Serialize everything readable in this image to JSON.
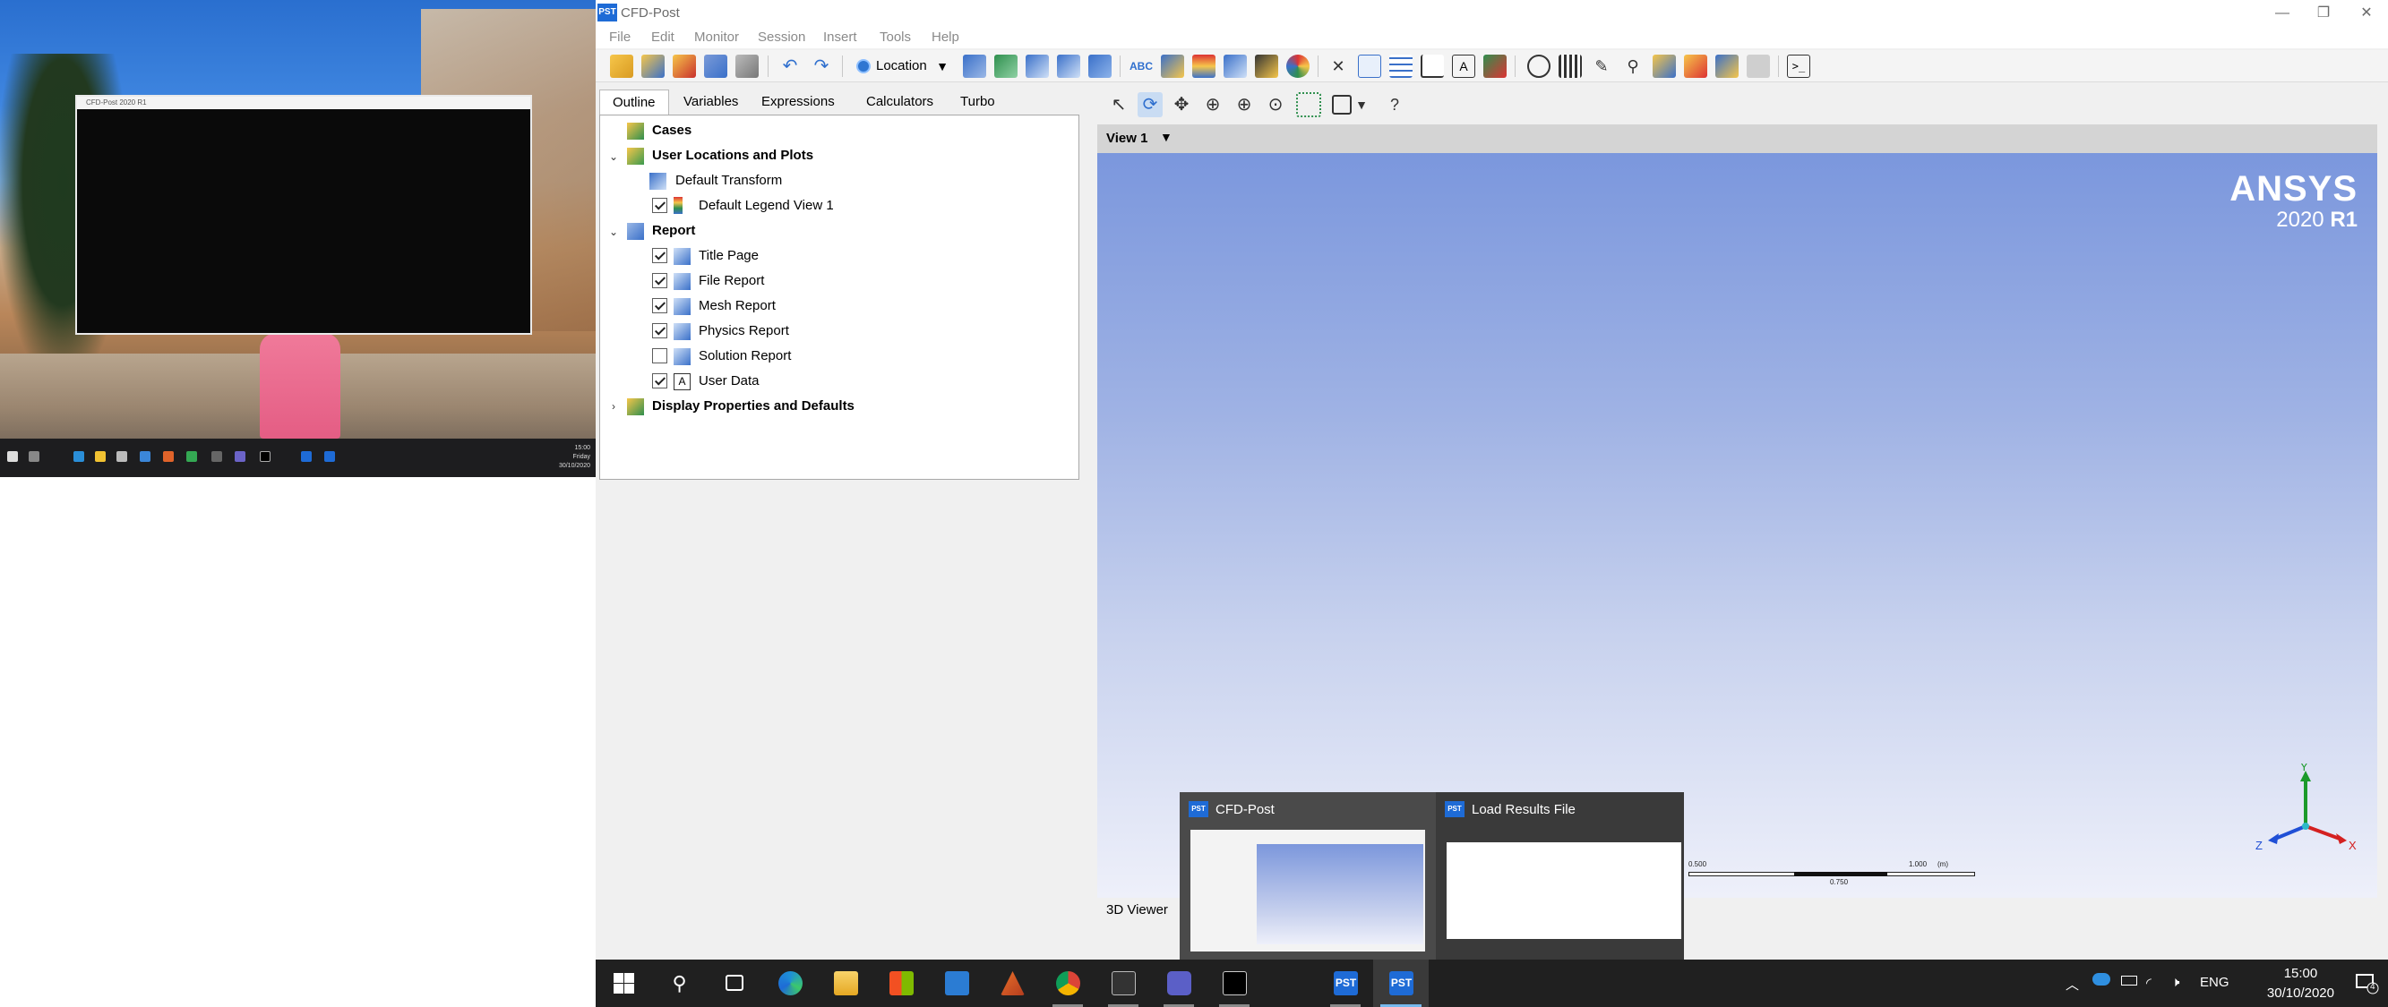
{
  "window": {
    "title": "CFD-Post",
    "icon_text": "PST",
    "minimize": "—",
    "restore": "❐",
    "close": "✕"
  },
  "menu": [
    "File",
    "Edit",
    "Monitor",
    "Session",
    "Insert",
    "Tools",
    "Help"
  ],
  "toolbar": {
    "location_label": "Location"
  },
  "panel": {
    "tabs": [
      "Outline",
      "Variables",
      "Expressions",
      "Calculators",
      "Turbo"
    ],
    "active_tab": "Outline",
    "tree": {
      "cases": "Cases",
      "user_locations": "User Locations and Plots",
      "default_transform": "Default Transform",
      "default_legend": "Default Legend View 1",
      "report": "Report",
      "report_items": [
        {
          "label": "Title Page",
          "checked": true
        },
        {
          "label": "File Report",
          "checked": true
        },
        {
          "label": "Mesh Report",
          "checked": true
        },
        {
          "label": "Physics Report",
          "checked": true
        },
        {
          "label": "Solution Report",
          "checked": false
        },
        {
          "label": "User Data",
          "checked": true
        }
      ],
      "display_properties": "Display Properties and Defaults"
    }
  },
  "viewer": {
    "view_name": "View 1",
    "footer_label": "3D Viewer",
    "brand_name": "ANSYS",
    "brand_year": "2020",
    "brand_release": "R1",
    "scale": {
      "left_label": "0.500",
      "right_label": "1.000",
      "unit": "(m)",
      "mid_label": "0.750"
    },
    "axes": {
      "x": "X",
      "y": "Y",
      "z": "Z"
    }
  },
  "preview": {
    "cards": [
      {
        "icon": "PST",
        "title": "CFD-Post"
      },
      {
        "icon": "PST",
        "title": "Load Results File"
      }
    ]
  },
  "taskbar": {
    "pst_label": "PST",
    "language": "ENG",
    "time": "15:00",
    "date": "30/10/2020",
    "notification_count": "4"
  },
  "second_screen": {
    "window_title": "CFD-Post 2020 R1",
    "clock_time": "15:00",
    "clock_day": "Friday",
    "clock_date": "30/10/2020"
  },
  "colors": {
    "accent": "#1e6bd6",
    "taskbar": "#202020",
    "viewport_top": "#7b97dd",
    "viewport_bottom": "#eef0fa"
  }
}
